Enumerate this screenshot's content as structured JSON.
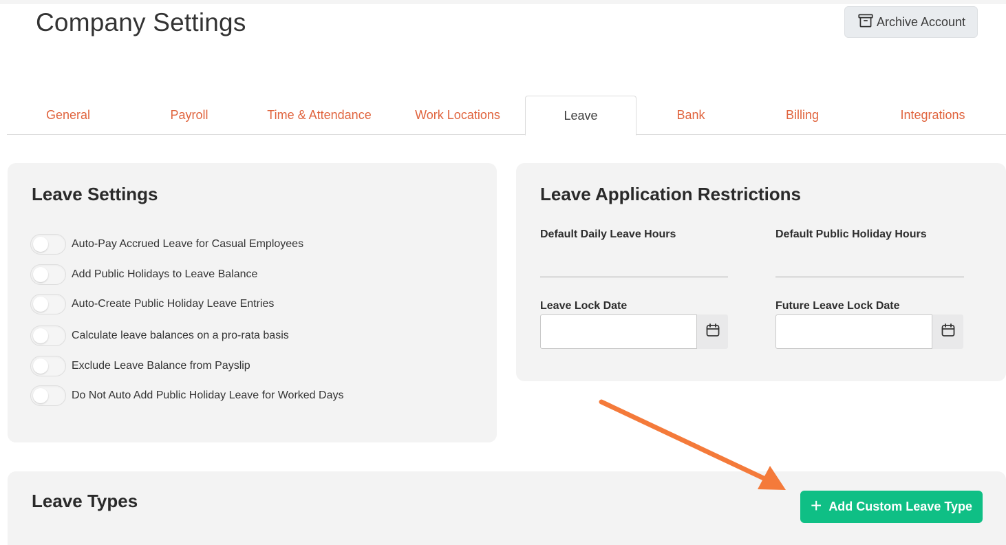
{
  "header": {
    "title": "Company Settings",
    "archive_button": "Archive Account"
  },
  "tabs": [
    {
      "label": "General",
      "active": false
    },
    {
      "label": "Payroll",
      "active": false
    },
    {
      "label": "Time & Attendance",
      "active": false
    },
    {
      "label": "Work Locations",
      "active": false
    },
    {
      "label": "Leave",
      "active": true
    },
    {
      "label": "Bank",
      "active": false
    },
    {
      "label": "Billing",
      "active": false
    },
    {
      "label": "Integrations",
      "active": false
    }
  ],
  "leave_settings": {
    "title": "Leave Settings",
    "toggles": [
      {
        "label": "Auto-Pay Accrued Leave for Casual Employees",
        "on": false
      },
      {
        "label": "Add Public Holidays to Leave Balance",
        "on": false
      },
      {
        "label": "Auto-Create Public Holiday Leave Entries",
        "on": false
      },
      {
        "label": "Calculate leave balances on a pro-rata basis",
        "on": false
      },
      {
        "label": "Exclude Leave Balance from Payslip",
        "on": false
      },
      {
        "label": "Do Not Auto Add Public Holiday Leave for Worked Days",
        "on": false
      }
    ]
  },
  "restrictions": {
    "title": "Leave Application Restrictions",
    "default_daily_label": "Default Daily Leave Hours",
    "default_daily_value": "",
    "default_holiday_label": "Default Public Holiday Hours",
    "default_holiday_value": "",
    "lock_date_label": "Leave Lock Date",
    "lock_date_value": "",
    "future_lock_label": "Future Leave Lock Date",
    "future_lock_value": ""
  },
  "leave_types": {
    "title": "Leave Types",
    "add_button": "Add Custom Leave Type"
  },
  "colors": {
    "tab_link": "#e0643e",
    "add_button": "#0fbf85",
    "annotation_arrow": "#f47a3a",
    "card_bg": "#f3f3f3"
  },
  "icons": {
    "archive": "archive-box-icon",
    "calendar": "calendar-icon",
    "plus": "plus-icon"
  }
}
